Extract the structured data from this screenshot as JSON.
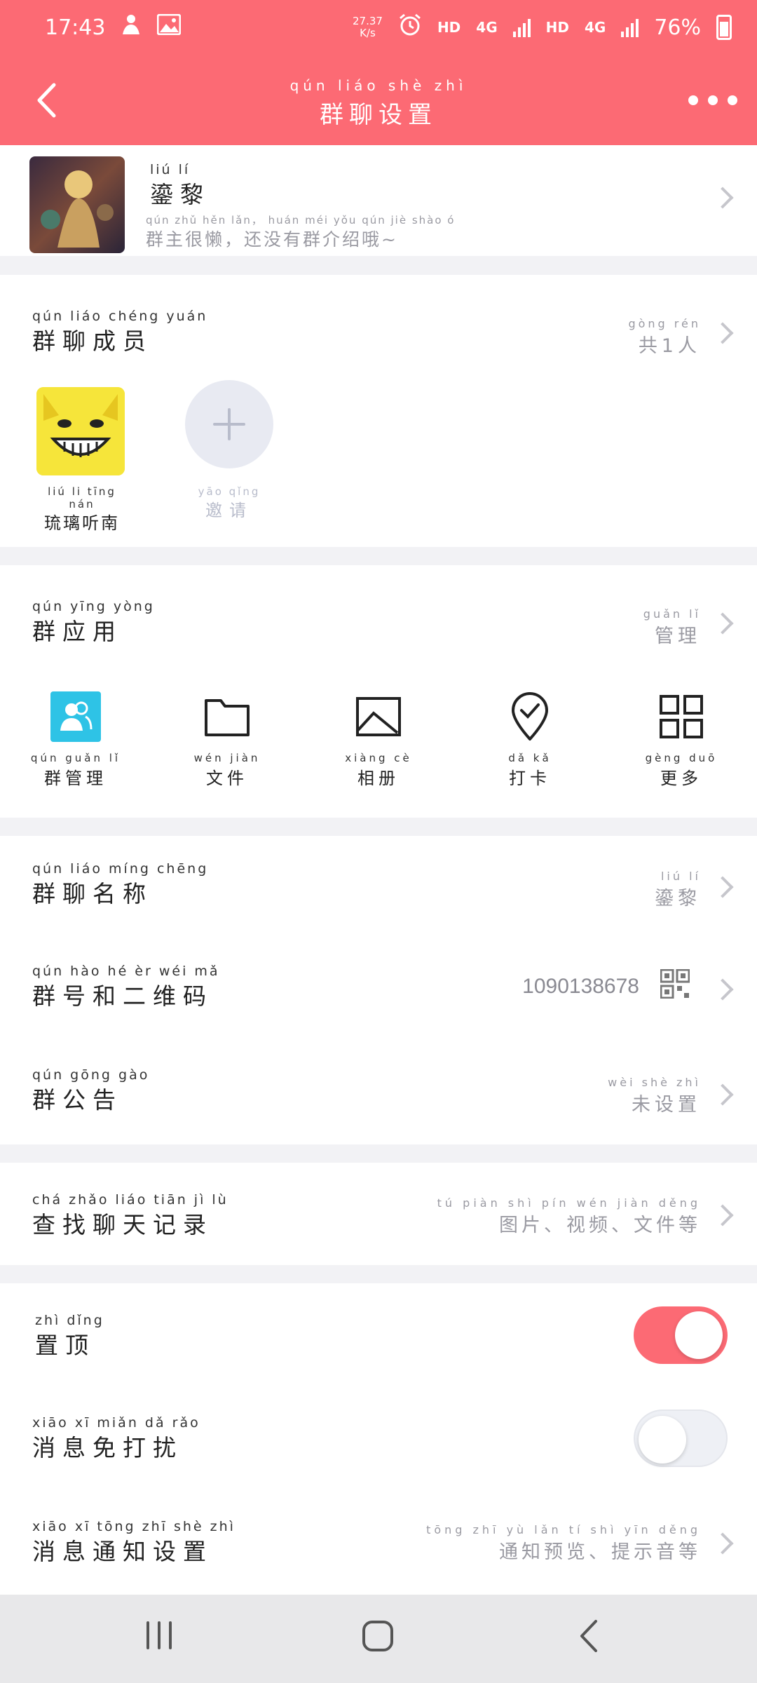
{
  "status_bar": {
    "time": "17:43",
    "speed_value": "27.37",
    "speed_unit": "K/s",
    "hd1": "HD",
    "net1": "4G",
    "hd2": "HD",
    "net2": "4G",
    "battery": "76%"
  },
  "header": {
    "title_pinyin": "qún liáo shè zhì",
    "title": "群聊设置",
    "accent_color": "#fc6a74"
  },
  "group": {
    "name_pinyin": "liú lí",
    "name": "鎏黎",
    "intro_pinyin": "qún zhǔ hěn lǎn， huán méi yǒu qún jiè shào ó",
    "intro": "群主很懒，还没有群介绍哦~"
  },
  "members": {
    "label_pinyin": "qún liáo chéng yuán",
    "label": "群聊成员",
    "count_pinyin": "gòng rén",
    "count": "共1人",
    "list": [
      {
        "name_pinyin": "liú li tīng nán",
        "name": "琉璃听南"
      }
    ],
    "invite_pinyin": "yāo qǐng",
    "invite": "邀请"
  },
  "apps": {
    "label_pinyin": "qún yīng yòng",
    "label": "群应用",
    "manage_pinyin": "guǎn lǐ",
    "manage": "管理",
    "items": [
      {
        "pinyin": "qún guǎn lǐ",
        "label": "群管理",
        "icon": "group-manage-icon"
      },
      {
        "pinyin": "wén jiàn",
        "label": "文件",
        "icon": "folder-icon"
      },
      {
        "pinyin": "xiàng cè",
        "label": "相册",
        "icon": "photo-album-icon"
      },
      {
        "pinyin": "dǎ kǎ",
        "label": "打卡",
        "icon": "check-in-icon"
      },
      {
        "pinyin": "gèng duō",
        "label": "更多",
        "icon": "more-grid-icon"
      }
    ]
  },
  "info_rows": {
    "name": {
      "label_pinyin": "qún liáo míng chēng",
      "label": "群聊名称",
      "value_pinyin": "liú lí",
      "value": "鎏黎"
    },
    "number": {
      "label_pinyin": "qún hào hé èr wéi mǎ",
      "label": "群号和二维码",
      "value": "1090138678"
    },
    "notice": {
      "label_pinyin": "qún gōng gào",
      "label": "群公告",
      "value_pinyin": "wèi shè zhì",
      "value": "未设置"
    }
  },
  "search_row": {
    "label_pinyin": "chá zhǎo liáo tiān jì lù",
    "label": "查找聊天记录",
    "value_pinyin": "tú piàn shì pín wén jiàn děng",
    "value": "图片、视频、文件等"
  },
  "settings": {
    "pin": {
      "label_pinyin": "zhì dǐng",
      "label": "置顶",
      "on": true
    },
    "dnd": {
      "label_pinyin": "xiāo xī miǎn dǎ rǎo",
      "label": "消息免打扰",
      "on": false
    },
    "notify": {
      "label_pinyin": "xiāo xī tōng zhī shè zhì",
      "label": "消息通知设置",
      "value_pinyin": "tōng zhī yù lǎn tí shì yīn děng",
      "value": "通知预览、提示音等"
    }
  }
}
